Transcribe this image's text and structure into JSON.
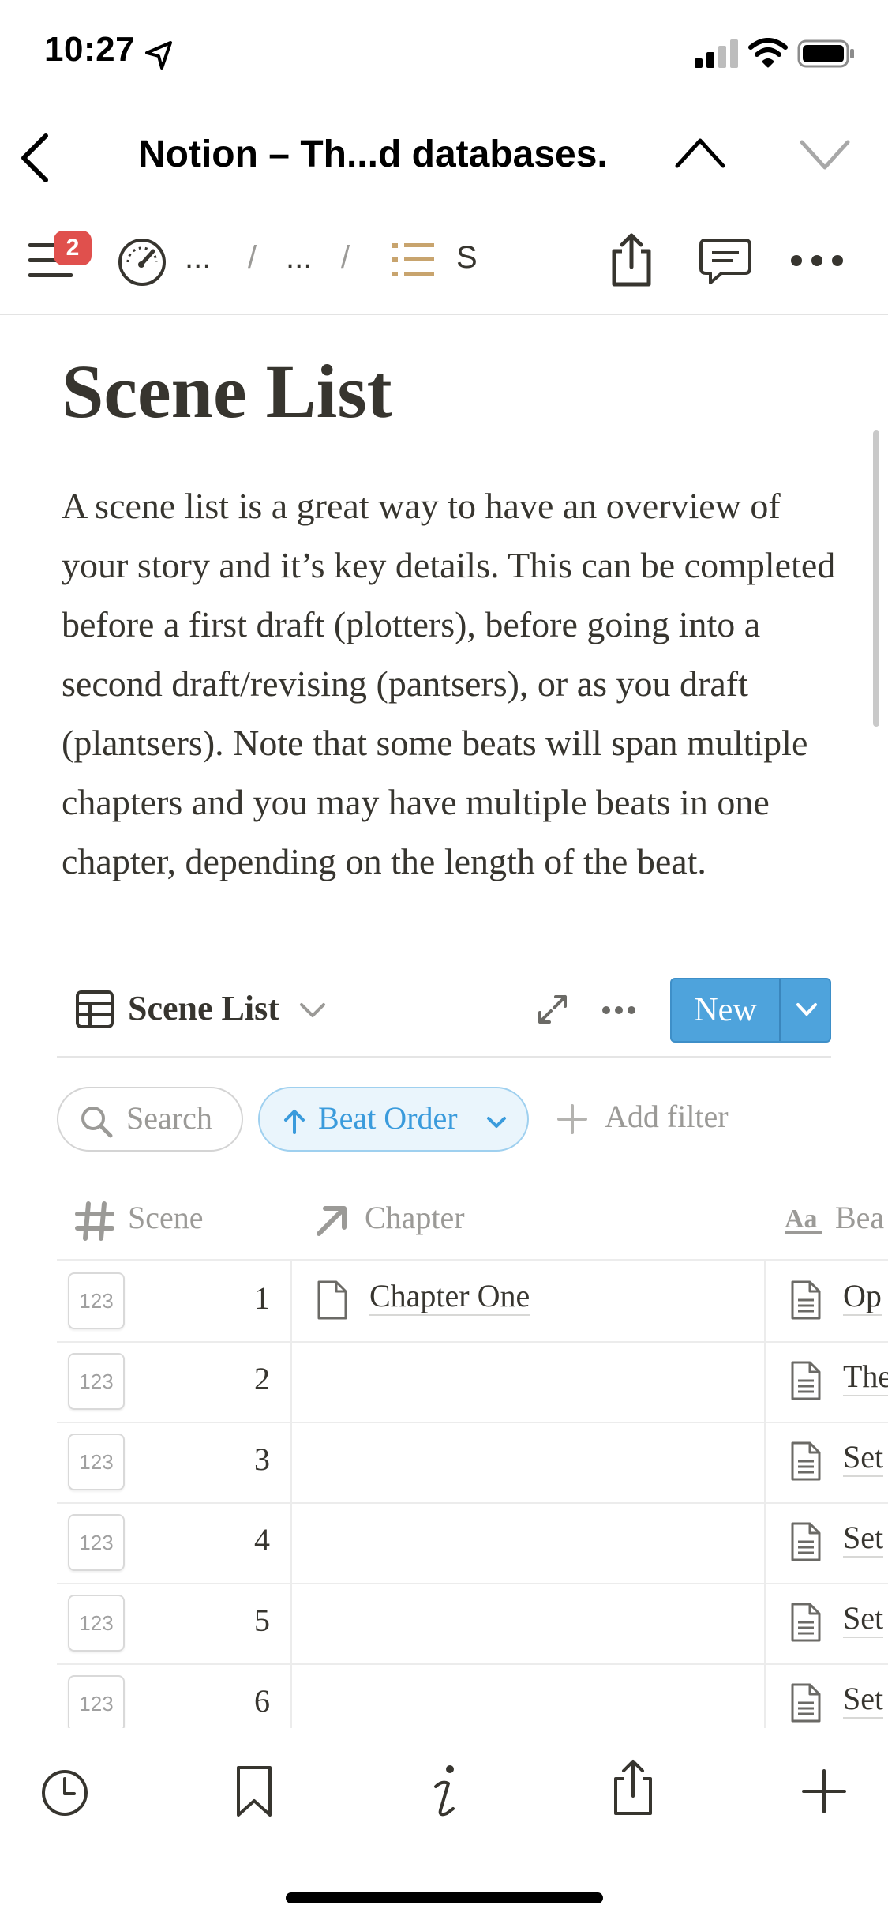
{
  "status_bar": {
    "time": "10:27"
  },
  "nav": {
    "title": "Notion – Th...d databases."
  },
  "toolbar": {
    "badge_count": "2",
    "crumb_1": "...",
    "sep_1": "/",
    "crumb_2": "...",
    "sep_2": "/",
    "crumb_3": "S"
  },
  "page": {
    "title": "Scene List",
    "description": "A scene list is a great way to have an overview of your story and it’s key details. This can be completed before a first draft (plotters), before going into a second draft/revising (pantsers), or as you draft (plantsers). Note that some beats will span multiple chapters and you may have multiple beats in one chapter, depending on the length of the beat."
  },
  "database": {
    "view_name": "Scene List",
    "new_label": "New",
    "search_label": "Search",
    "sort_label": "Beat Order",
    "add_filter_label": "Add filter",
    "columns": {
      "scene": "Scene",
      "chapter": "Chapter",
      "beat": "Bea"
    },
    "rows": [
      {
        "icon": "123",
        "scene": "1",
        "chapter": "Chapter One",
        "beat": "Op"
      },
      {
        "icon": "123",
        "scene": "2",
        "chapter": "",
        "beat": "The"
      },
      {
        "icon": "123",
        "scene": "3",
        "chapter": "",
        "beat": "Set"
      },
      {
        "icon": "123",
        "scene": "4",
        "chapter": "",
        "beat": "Set"
      },
      {
        "icon": "123",
        "scene": "5",
        "chapter": "",
        "beat": "Set"
      },
      {
        "icon": "123",
        "scene": "6",
        "chapter": "",
        "beat": "Set"
      }
    ]
  },
  "colors": {
    "accent": "#4ea3dc",
    "badge": "#e0504d",
    "text": "#37352f",
    "muted": "#9b9a97",
    "list_icon": "#c8a46e"
  },
  "icons": [
    "location-arrow-icon",
    "signal-icon",
    "wifi-icon",
    "battery-icon",
    "back-chevron-icon",
    "chevron-up-icon",
    "chevron-down-icon",
    "sidebar-menu-icon",
    "gauge-icon",
    "list-icon",
    "share-icon",
    "comment-icon",
    "more-icon",
    "table-icon",
    "expand-icon",
    "search-icon",
    "arrow-up-icon",
    "plus-icon",
    "hash-icon",
    "relation-arrow-icon",
    "text-property-icon",
    "page-icon",
    "history-icon",
    "bookmark-icon",
    "info-icon"
  ]
}
